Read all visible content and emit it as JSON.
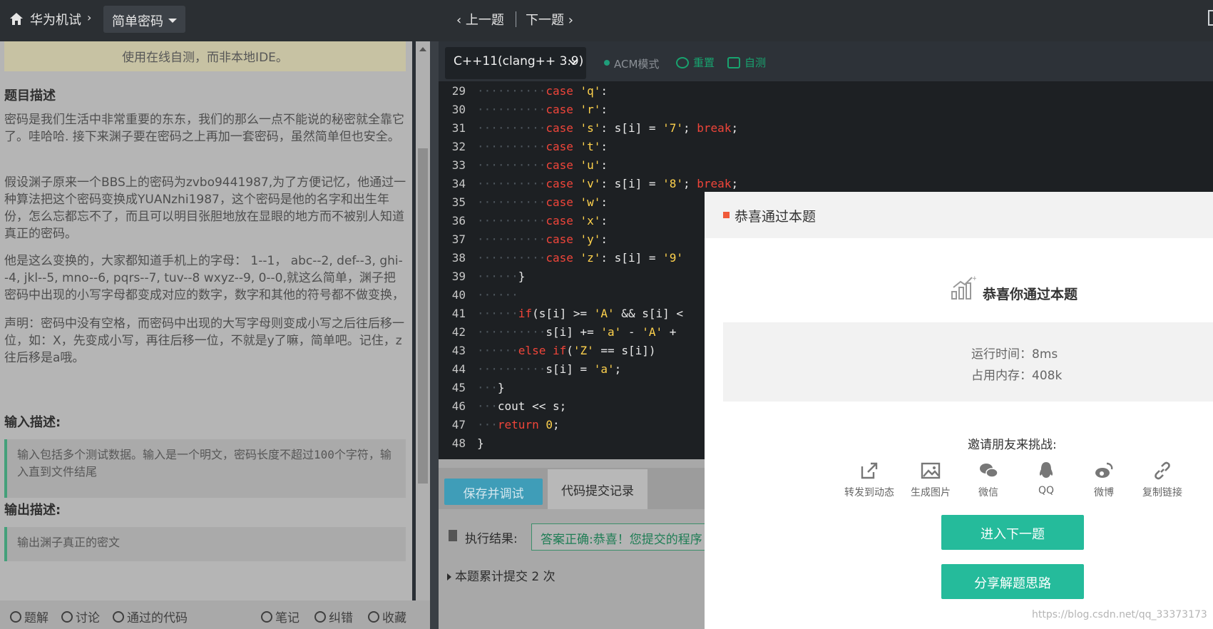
{
  "topbar": {
    "breadcrumb": "华为机试",
    "mode": "简单密码",
    "prev": "上一题",
    "next": "下一题"
  },
  "problem": {
    "notice": "使用在线自测，而非本地IDE。",
    "desc_title": "题目描述",
    "desc_p1": "密码是我们生活中非常重要的东东，我们的那么一点不能说的秘密就全靠它了。哇哈哈. 接下来渊子要在密码之上再加一套密码，虽然简单但也安全。",
    "desc_p2": "假设渊子原来一个BBS上的密码为zvbo9441987,为了方便记忆，他通过一种算法把这个密码变换成YUANzhi1987，这个密码是他的名字和出生年份，怎么忘都忘不了，而且可以明目张胆地放在显眼的地方而不被别人知道真正的密码。",
    "desc_p3": "他是这么变换的，大家都知道手机上的字母： 1--1， abc--2, def--3, ghi--4, jkl--5, mno--6, pqrs--7, tuv--8 wxyz--9, 0--0,就这么简单，渊子把密码中出现的小写字母都变成对应的数字，数字和其他的符号都不做变换，",
    "desc_p4": "声明：密码中没有空格，而密码中出现的大写字母则变成小写之后往后移一位，如：X，先变成小写，再往后移一位，不就是y了嘛，简单吧。记住，z往后移是a哦。",
    "input_title": "输入描述:",
    "input_text": "输入包括多个测试数据。输入是一个明文，密码长度不超过100个字符，输入直到文件结尾",
    "output_title": "输出描述:",
    "output_text": "输出渊子真正的密文"
  },
  "footer": {
    "solution": "题解",
    "discuss": "讨论",
    "passed_code": "通过的代码",
    "notes": "笔记",
    "correction": "纠错",
    "favorite": "收藏"
  },
  "editor": {
    "language": "C++11(clang++ 3.9)",
    "mode": "ACM模式",
    "reset": "重置",
    "self_test": "自测",
    "lines": [
      {
        "n": "29",
        "dots": "··········",
        "code": [
          [
            "kw",
            "case"
          ],
          [
            "t",
            " "
          ],
          [
            "st",
            "'q'"
          ],
          [
            "t",
            ":"
          ]
        ]
      },
      {
        "n": "30",
        "dots": "··········",
        "code": [
          [
            "kw",
            "case"
          ],
          [
            "t",
            " "
          ],
          [
            "st",
            "'r'"
          ],
          [
            "t",
            ":"
          ]
        ]
      },
      {
        "n": "31",
        "dots": "··········",
        "code": [
          [
            "kw",
            "case"
          ],
          [
            "t",
            " "
          ],
          [
            "st",
            "'s'"
          ],
          [
            "t",
            ": s[i] = "
          ],
          [
            "st",
            "'7'"
          ],
          [
            "t",
            "; "
          ],
          [
            "kw",
            "break"
          ],
          [
            "t",
            ";"
          ]
        ]
      },
      {
        "n": "32",
        "dots": "··········",
        "code": [
          [
            "kw",
            "case"
          ],
          [
            "t",
            " "
          ],
          [
            "st",
            "'t'"
          ],
          [
            "t",
            ":"
          ]
        ]
      },
      {
        "n": "33",
        "dots": "··········",
        "code": [
          [
            "kw",
            "case"
          ],
          [
            "t",
            " "
          ],
          [
            "st",
            "'u'"
          ],
          [
            "t",
            ":"
          ]
        ]
      },
      {
        "n": "34",
        "dots": "··········",
        "code": [
          [
            "kw",
            "case"
          ],
          [
            "t",
            " "
          ],
          [
            "st",
            "'v'"
          ],
          [
            "t",
            ": s[i] = "
          ],
          [
            "st",
            "'8'"
          ],
          [
            "t",
            "; "
          ],
          [
            "kw",
            "break"
          ],
          [
            "t",
            ";"
          ]
        ]
      },
      {
        "n": "35",
        "dots": "··········",
        "code": [
          [
            "kw",
            "case"
          ],
          [
            "t",
            " "
          ],
          [
            "st",
            "'w'"
          ],
          [
            "t",
            ":"
          ]
        ]
      },
      {
        "n": "36",
        "dots": "··········",
        "code": [
          [
            "kw",
            "case"
          ],
          [
            "t",
            " "
          ],
          [
            "st",
            "'x'"
          ],
          [
            "t",
            ":"
          ]
        ]
      },
      {
        "n": "37",
        "dots": "··········",
        "code": [
          [
            "kw",
            "case"
          ],
          [
            "t",
            " "
          ],
          [
            "st",
            "'y'"
          ],
          [
            "t",
            ":"
          ]
        ]
      },
      {
        "n": "38",
        "dots": "··········",
        "code": [
          [
            "kw",
            "case"
          ],
          [
            "t",
            " "
          ],
          [
            "st",
            "'z'"
          ],
          [
            "t",
            ": s[i] = "
          ],
          [
            "st",
            "'9'"
          ]
        ]
      },
      {
        "n": "39",
        "dots": "······",
        "code": [
          [
            "t",
            "}"
          ]
        ]
      },
      {
        "n": "40",
        "dots": "······",
        "code": []
      },
      {
        "n": "41",
        "dots": "······",
        "code": [
          [
            "kw",
            "if"
          ],
          [
            "t",
            "(s[i] >= "
          ],
          [
            "st",
            "'A'"
          ],
          [
            "t",
            " && s[i] <"
          ]
        ]
      },
      {
        "n": "42",
        "dots": "··········",
        "code": [
          [
            "t",
            "s[i] += "
          ],
          [
            "st",
            "'a'"
          ],
          [
            "t",
            " - "
          ],
          [
            "st",
            "'A'"
          ],
          [
            "t",
            " +"
          ]
        ]
      },
      {
        "n": "43",
        "dots": "······",
        "code": [
          [
            "kw",
            "else if"
          ],
          [
            "t",
            "("
          ],
          [
            "st",
            "'Z'"
          ],
          [
            "t",
            " == s[i])"
          ]
        ]
      },
      {
        "n": "44",
        "dots": "··········",
        "code": [
          [
            "t",
            "s[i] = "
          ],
          [
            "st",
            "'a'"
          ],
          [
            "t",
            ";"
          ]
        ]
      },
      {
        "n": "45",
        "dots": "···",
        "code": [
          [
            "t",
            "}"
          ]
        ]
      },
      {
        "n": "46",
        "dots": "···",
        "code": [
          [
            "t",
            "cout << s;"
          ]
        ]
      },
      {
        "n": "47",
        "dots": "···",
        "code": [
          [
            "kw",
            "return"
          ],
          [
            "t",
            " "
          ],
          [
            "st",
            "0"
          ],
          [
            "t",
            ";"
          ]
        ]
      },
      {
        "n": "48",
        "dots": "",
        "code": [
          [
            "t",
            "}"
          ]
        ]
      }
    ]
  },
  "actions": {
    "save_debug": "保存并调试",
    "submit_history": "代码提交记录",
    "exec_label": "执行结果:",
    "result": "答案正确:恭喜！您提交的程序",
    "count": "本题累计提交 2 次"
  },
  "modal": {
    "header": "恭喜通过本题",
    "pass_title": "恭喜你通过本题",
    "runtime": "运行时间：8ms",
    "memory": "占用内存：408k",
    "invite": "邀请朋友来挑战:",
    "share": [
      "转发到动态",
      "生成图片",
      "微信",
      "QQ",
      "微博",
      "复制链接"
    ],
    "next_btn": "进入下一题",
    "share_btn": "分享解题思路"
  },
  "watermark": "https://blog.csdn.net/qq_33373173",
  "colors": {
    "accent_green": "#25bb9b",
    "keyword": "#f0453a",
    "string": "#ffd24d",
    "result_text": "#1f7d55"
  }
}
